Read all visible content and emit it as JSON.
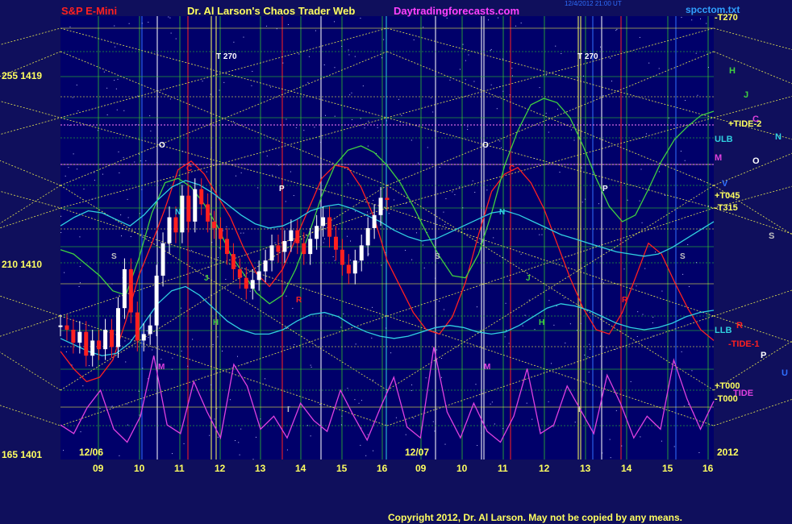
{
  "header": {
    "instrument": "S&P E-Mini",
    "title": "Dr. Al Larson's Chaos Trader Web",
    "site": "Daytradingforecasts.com",
    "timestamp": "12/4/2012 21:00 UT",
    "file": "spcctom.txt",
    "copyright": "Copyright 2012, Dr. Al Larson. May not be copied by any means."
  },
  "colors": {
    "background": "#0f0f5c",
    "plot_background": "#00006a",
    "title_red": "#ff2020",
    "title_yellow": "#ffff60",
    "site_magenta": "#ff40ff",
    "file_cyan": "#30a0ff",
    "grid_yellow": "#e8e850",
    "grid_green": "#30c030",
    "cyan": "#30d0e0",
    "red": "#ff2020",
    "green": "#40d040",
    "magenta": "#e040e0",
    "white": "#ffffff"
  },
  "chart_data": {
    "type": "line",
    "title": "S&P E-Mini",
    "y_axis": {
      "labels": [
        "255 1419",
        "210 1410",
        "165 1401"
      ],
      "price_ticks": [
        1419,
        1410,
        1401
      ],
      "ylim": [
        1401,
        1421.5
      ]
    },
    "x_axis": {
      "hours": [
        "09",
        "10",
        "11",
        "12",
        "13",
        "14",
        "15",
        "16",
        "09",
        "10",
        "11",
        "12",
        "13",
        "14",
        "15",
        "16"
      ],
      "date_labels": [
        "12/06",
        "12/07",
        "2012"
      ]
    },
    "right_labels": [
      "-T270",
      "+TIDE-2",
      "ULB",
      "+T045",
      "-T315",
      "LLB",
      "-TIDE-1",
      "+T000",
      "-T000",
      "TIDE"
    ],
    "planet_markers": [
      "H",
      "J",
      "C",
      "N",
      "M",
      "O",
      "V",
      "S",
      "R",
      "P",
      "U"
    ],
    "time_markers": [
      "T  270",
      "T  270"
    ],
    "chart_letters": [
      "O",
      "C",
      "N",
      "P",
      "S",
      "J",
      "H",
      "R",
      "M",
      "I"
    ],
    "price_series": [
      {
        "name": "",
        "color": "white",
        "values": [
          1407.2,
          1407.0,
          1406.4,
          1406.9,
          1405.8,
          1406.5,
          1406.1,
          1407.0,
          1406.2,
          1408.0,
          1409.8,
          1407.8,
          1406.5,
          1406.8,
          1407.2,
          1409.5,
          1411.0,
          1412.2,
          1411.5,
          1413.2,
          1412.0,
          1413.5,
          1412.8,
          1412.0,
          1411.7,
          1411.2,
          1410.5,
          1409.8,
          1409.4,
          1408.9,
          1409.3,
          1409.7,
          1410.2,
          1410.9,
          1410.6,
          1411.1,
          1411.6,
          1411.0,
          1410.5,
          1411.2,
          1411.8,
          1412.2,
          1411.3,
          1410.7,
          1410.0,
          1409.6,
          1410.2,
          1410.9,
          1411.7,
          1412.3,
          1413.1,
          1413.0
        ]
      }
    ],
    "curves": [
      {
        "name": "",
        "color": "red",
        "values": [
          1406,
          1405.2,
          1404.6,
          1404.8,
          1405.6,
          1407.4,
          1409.5,
          1411,
          1412.6,
          1414.4,
          1414.8,
          1414.2,
          1413.2,
          1412.2,
          1410.8,
          1409.6,
          1409,
          1409.8,
          1411.2,
          1412.6,
          1414,
          1414.6,
          1414.5,
          1413.6,
          1412.2,
          1410.2,
          1409,
          1407.8,
          1407,
          1406.8,
          1407.6,
          1409.2,
          1411.4,
          1413.4,
          1414.2,
          1414.5,
          1413.8,
          1412.6,
          1411,
          1409.4,
          1408,
          1407,
          1406.8,
          1407.8,
          1409.4,
          1411,
          1410.5,
          1409.2,
          1408,
          1407,
          1406.5
        ]
      },
      {
        "name": "",
        "color": "green",
        "values": [
          1410.7,
          1410.5,
          1410,
          1409.5,
          1408.8,
          1408.6,
          1410.3,
          1412.4,
          1413.8,
          1414,
          1413.6,
          1412.8,
          1411.8,
          1410.5,
          1409.6,
          1408.7,
          1408.2,
          1408.6,
          1409.8,
          1411.4,
          1413.2,
          1414.6,
          1415.3,
          1415.5,
          1415.2,
          1414.6,
          1413.8,
          1412.7,
          1411.5,
          1410.4,
          1409.5,
          1409.4,
          1410.5,
          1412.4,
          1414.6,
          1416.2,
          1417.4,
          1417.7,
          1417.5,
          1416.8,
          1415.5,
          1414,
          1412.7,
          1412,
          1412.3,
          1413.5,
          1414.8,
          1415.8,
          1416.4,
          1416.9,
          1417.1
        ]
      },
      {
        "name": "",
        "color": "cyan",
        "values": [
          1411.8,
          1412.2,
          1412.5,
          1412.4,
          1412.1,
          1411.8,
          1412.3,
          1413,
          1413.6,
          1413.9,
          1413.7,
          1413.3,
          1412.8,
          1412.3,
          1411.9,
          1411.7,
          1411.8,
          1412.1,
          1412.5,
          1412.7,
          1412.8,
          1412.6,
          1412.3,
          1412,
          1411.6,
          1411.3,
          1411.1,
          1411.2,
          1411.5,
          1411.8,
          1412.1,
          1412.4,
          1412.5,
          1412.3,
          1412,
          1411.7,
          1411.4,
          1411.2,
          1411,
          1410.8,
          1410.6,
          1410.5,
          1410.4,
          1410.5,
          1410.8,
          1411.2,
          1411.6,
          1412
        ]
      },
      {
        "name": "",
        "color": "cyan",
        "values": [
          1406.6,
          1406.3,
          1406,
          1405.8,
          1405.9,
          1406.4,
          1407.3,
          1408.2,
          1408.8,
          1409,
          1408.6,
          1408,
          1407.4,
          1407,
          1406.8,
          1406.8,
          1407,
          1407.4,
          1407.7,
          1407.8,
          1407.6,
          1407.2,
          1406.9,
          1406.7,
          1406.6,
          1406.7,
          1406.9,
          1407.1,
          1407.2,
          1407.1,
          1406.9,
          1406.8,
          1406.9,
          1407.2,
          1407.6,
          1408,
          1408.2,
          1408.1,
          1407.9,
          1407.6,
          1407.3,
          1407.1,
          1407,
          1407.1,
          1407.3,
          1407.6,
          1407.8,
          1407.9
        ]
      },
      {
        "name": "",
        "color": "magenta",
        "values": [
          1402.6,
          1402.2,
          1403.4,
          1404.2,
          1402.4,
          1401.8,
          1403,
          1405.8,
          1402.6,
          1402.2,
          1404.6,
          1403.2,
          1402,
          1405.4,
          1404.4,
          1402.4,
          1403,
          1402,
          1403.6,
          1402.8,
          1402.3,
          1404.2,
          1403,
          1401.9,
          1403.4,
          1404.8,
          1402.5,
          1402,
          1406.2,
          1403.2,
          1402,
          1403.6,
          1402.3,
          1401.8,
          1403,
          1405.2,
          1402.2,
          1402.6,
          1404.4,
          1403.3,
          1402.2,
          1404.9,
          1403.6,
          1402,
          1403,
          1402.4,
          1405.6,
          1403.8,
          1402.4,
          1403.7
        ]
      }
    ]
  }
}
